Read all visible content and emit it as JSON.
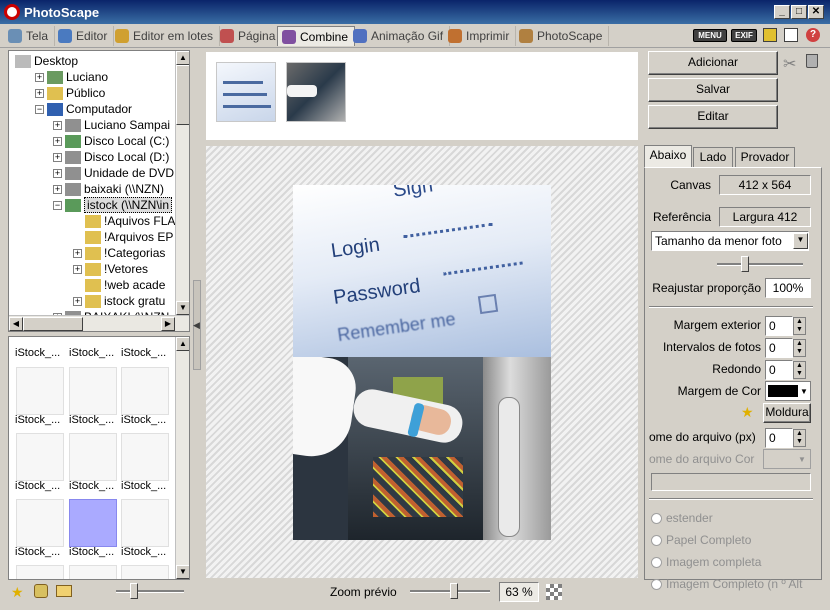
{
  "window": {
    "title": "PhotoScape"
  },
  "tabs": [
    {
      "label": "Tela"
    },
    {
      "label": "Editor"
    },
    {
      "label": "Editor em lotes"
    },
    {
      "label": "Página"
    },
    {
      "label": "Combine"
    },
    {
      "label": "Animação Gif"
    },
    {
      "label": "Imprimir"
    },
    {
      "label": "PhotoScape"
    }
  ],
  "toolbar_icons": {
    "menu": "MENU",
    "exif": "EXIF"
  },
  "tree": {
    "items": [
      "Desktop",
      "Luciano",
      "Público",
      "Computador",
      "Luciano Sampai",
      "Disco Local (C:)",
      "Disco Local (D:)",
      "Unidade de DVD",
      "baixaki (\\\\NZN)",
      "istock (\\\\NZN\\in",
      "!Aquivos FLA",
      "!Arquivos EP",
      "!Categorias",
      "!Vetores",
      "!web acade",
      "istock gratu",
      "BAIXAKI (\\\\NZN"
    ]
  },
  "thumbnails": {
    "label": "iStock_..."
  },
  "strip": {
    "items": [
      "login-photo",
      "hardware-photo"
    ]
  },
  "preview_image": {
    "login_text": "Login",
    "password_text": "Password",
    "remember_text": "Remember me",
    "sign_text": "Sign"
  },
  "zoom": {
    "label": "Zoom prévio",
    "value": "63 %"
  },
  "actions": {
    "add": "Adicionar",
    "save": "Salvar",
    "edit": "Editar"
  },
  "right_tabs": [
    "Abaixo",
    "Lado",
    "Provador"
  ],
  "settings": {
    "canvas_label": "Canvas",
    "canvas_value": "412 x 564",
    "reference_label": "Referência",
    "reference_value": "Largura 412",
    "size_mode": "Tamanho da menor foto",
    "resize_label": "Reajustar proporção",
    "resize_value": "100%",
    "outer_margin_label": "Margem exterior",
    "outer_margin_value": "0",
    "photo_interval_label": "Intervalos de fotos",
    "photo_interval_value": "0",
    "round_label": "Redondo",
    "round_value": "0",
    "margin_color_label": "Margem de Cor",
    "margin_color": "#000000",
    "frame_button": "Moldura",
    "filename_px_label": "ome do arquivo (px)",
    "filename_px_value": "0",
    "filename_color_label": "ome do arquivo Cor"
  },
  "output_options": [
    "estender",
    "Papel Completo",
    "Imagem completa",
    "Imagem Completo (n º Alt"
  ]
}
